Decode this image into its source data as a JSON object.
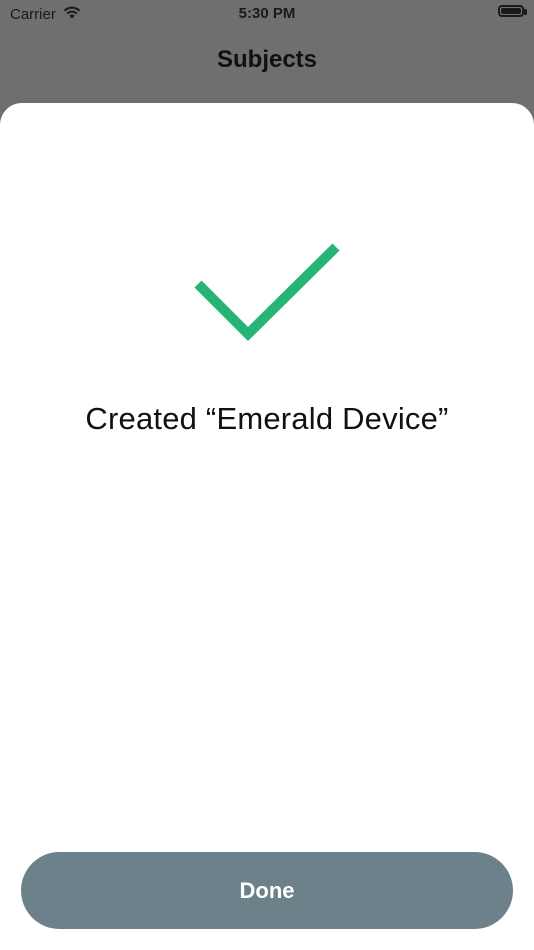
{
  "status_bar": {
    "carrier": "Carrier",
    "time": "5:30 PM"
  },
  "nav": {
    "title": "Subjects"
  },
  "modal": {
    "message": "Created “Emerald Device”",
    "done_label": "Done"
  },
  "colors": {
    "check_green": "#27b477",
    "button_bg": "#6c818a"
  },
  "icons": {
    "success": "checkmark-icon",
    "wifi": "wifi-icon",
    "battery": "battery-icon"
  }
}
